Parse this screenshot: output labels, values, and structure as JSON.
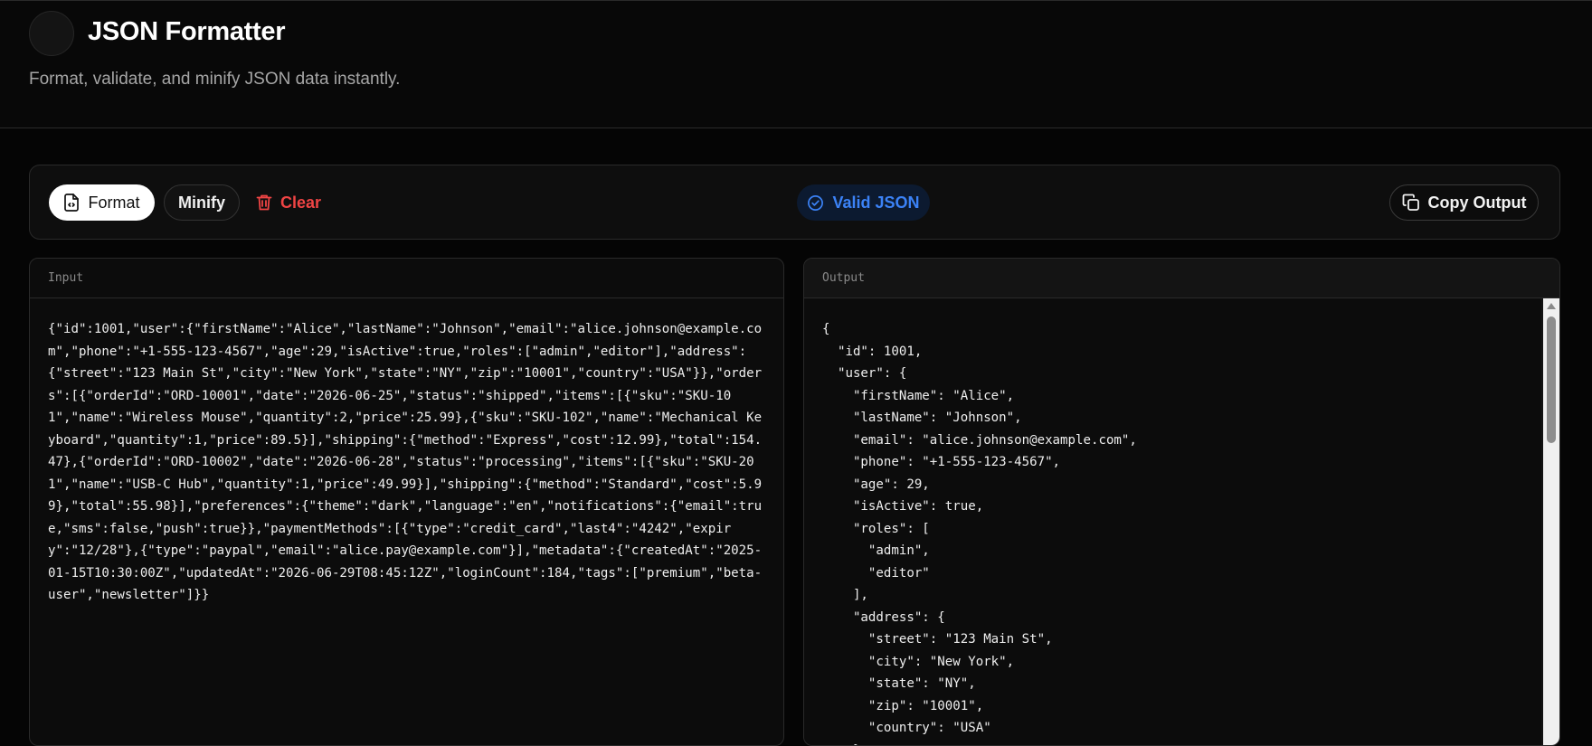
{
  "header": {
    "title": "JSON Formatter",
    "subtitle": "Format, validate, and minify JSON data instantly."
  },
  "toolbar": {
    "format_label": "Format",
    "minify_label": "Minify",
    "clear_label": "Clear",
    "status_label": "Valid JSON",
    "copy_label": "Copy Output"
  },
  "colors": {
    "accent_blue": "#3b82f6",
    "danger_red": "#ef4444",
    "background": "#050505"
  },
  "input": {
    "label": "Input",
    "value": "{\"id\":1001,\"user\":{\"firstName\":\"Alice\",\"lastName\":\"Johnson\",\"email\":\"alice.johnson@example.com\",\"phone\":\"+1-555-123-4567\",\"age\":29,\"isActive\":true,\"roles\":[\"admin\",\"editor\"],\"address\":{\"street\":\"123 Main St\",\"city\":\"New York\",\"state\":\"NY\",\"zip\":\"10001\",\"country\":\"USA\"}},\"orders\":[{\"orderId\":\"ORD-10001\",\"date\":\"2026-06-25\",\"status\":\"shipped\",\"items\":[{\"sku\":\"SKU-101\",\"name\":\"Wireless Mouse\",\"quantity\":2,\"price\":25.99},{\"sku\":\"SKU-102\",\"name\":\"Mechanical Keyboard\",\"quantity\":1,\"price\":89.5}],\"shipping\":{\"method\":\"Express\",\"cost\":12.99},\"total\":154.47},{\"orderId\":\"ORD-10002\",\"date\":\"2026-06-28\",\"status\":\"processing\",\"items\":[{\"sku\":\"SKU-201\",\"name\":\"USB-C Hub\",\"quantity\":1,\"price\":49.99}],\"shipping\":{\"method\":\"Standard\",\"cost\":5.99},\"total\":55.98}],\"preferences\":{\"theme\":\"dark\",\"language\":\"en\",\"notifications\":{\"email\":true,\"sms\":false,\"push\":true}},\"paymentMethods\":[{\"type\":\"credit_card\",\"last4\":\"4242\",\"expiry\":\"12/28\"},{\"type\":\"paypal\",\"email\":\"alice.pay@example.com\"}],\"metadata\":{\"createdAt\":\"2025-01-15T10:30:00Z\",\"updatedAt\":\"2026-06-29T08:45:12Z\",\"loginCount\":184,\"tags\":[\"premium\",\"beta-user\",\"newsletter\"]}}"
  },
  "output": {
    "label": "Output",
    "value": "{\n  \"id\": 1001,\n  \"user\": {\n    \"firstName\": \"Alice\",\n    \"lastName\": \"Johnson\",\n    \"email\": \"alice.johnson@example.com\",\n    \"phone\": \"+1-555-123-4567\",\n    \"age\": 29,\n    \"isActive\": true,\n    \"roles\": [\n      \"admin\",\n      \"editor\"\n    ],\n    \"address\": {\n      \"street\": \"123 Main St\",\n      \"city\": \"New York\",\n      \"state\": \"NY\",\n      \"zip\": \"10001\",\n      \"country\": \"USA\"\n    }"
  }
}
